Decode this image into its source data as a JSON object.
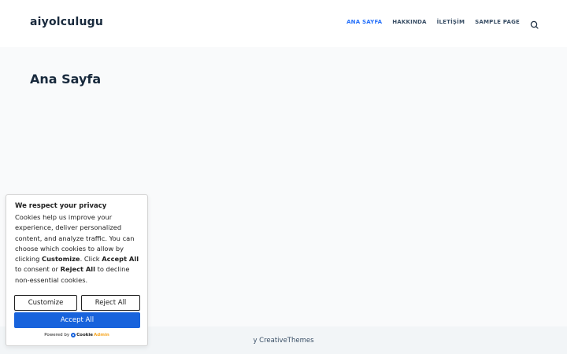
{
  "header": {
    "site_title": "aiyolculugu",
    "nav": [
      {
        "label": "ANA SAYFA",
        "active": true
      },
      {
        "label": "HAKKINDA",
        "active": false
      },
      {
        "label": "İLETİŞİM",
        "active": false
      },
      {
        "label": "SAMPLE PAGE",
        "active": false
      }
    ],
    "search_icon": "search-icon"
  },
  "main": {
    "page_title": "Ana Sayfa"
  },
  "footer": {
    "prefix": "y ",
    "creator": "CreativeThemes"
  },
  "cookie_banner": {
    "title": "We respect your privacy",
    "desc_1": "Cookies help us improve your experience, deliver personalized content, and analyze traffic. You can choose which cookies to allow by clicking ",
    "desc_b1": "Customize",
    "desc_2": ". Click ",
    "desc_b2": "Accept All",
    "desc_3": " to consent or ",
    "desc_b3": "Reject All",
    "desc_4": " to decline non-essential cookies.",
    "customize_label": "Customize",
    "reject_label": "Reject All",
    "accept_label": "Accept All",
    "powered_by": "Powered by",
    "brand_part1": "Cookie",
    "brand_part2": "Admin"
  },
  "colors": {
    "accent": "#2872fa",
    "button_blue": "#1863dc",
    "text_dark": "#192a3d",
    "background": "#f9fafb"
  }
}
